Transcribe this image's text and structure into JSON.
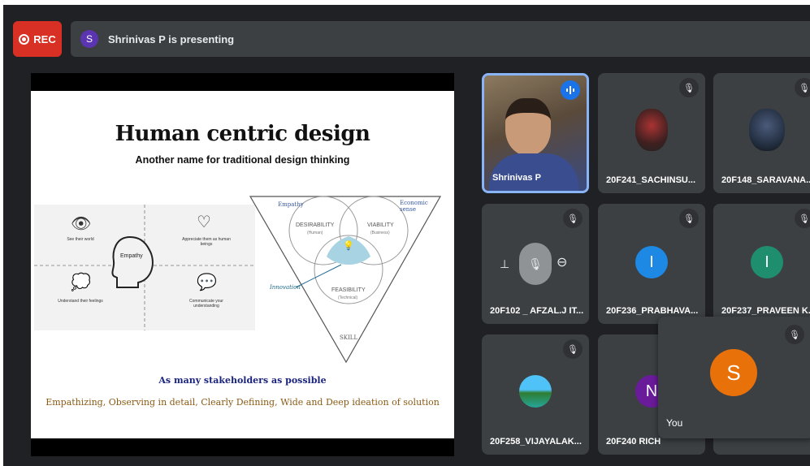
{
  "recording": {
    "label": "REC"
  },
  "presenter_bar": {
    "avatar_letter": "S",
    "text": "Shrinivas P is presenting"
  },
  "slide": {
    "title": "Human centric design",
    "subtitle": "Another name for traditional design thinking",
    "empathy_center": "Empathy",
    "empathy_items": [
      "See their world",
      "Appreciate them as human beings",
      "Understand their feelings",
      "Communicate your understanding"
    ],
    "venn": {
      "top_left": "Empathy",
      "top_right": "Economic sense",
      "circle_desirability": "DESIRABILITY",
      "circle_desirability_sub": "(Human)",
      "circle_viability": "VIABILITY",
      "circle_viability_sub": "(Business)",
      "circle_feasibility": "FEASIBILITY",
      "circle_feasibility_sub": "(Technical)",
      "innovation": "Innovation",
      "skill": "SKILL"
    },
    "stakeholders": "As many stakeholders as possible",
    "methods": "Empathizing, Observing in detail, Clearly Defining, Wide and Deep ideation of solution"
  },
  "participants": [
    {
      "name": "Shrinivas P",
      "type": "video",
      "speaking": true
    },
    {
      "name": "20F241_SACHINSU...",
      "type": "photo",
      "muted": true
    },
    {
      "name": "20F148_SARAVANA...",
      "type": "photo",
      "muted": true
    },
    {
      "name": "20F102 _ AFZAL.J IT...",
      "type": "controls",
      "muted": true
    },
    {
      "name": "20F236_PRABHAVA...",
      "type": "letter",
      "letter": "I",
      "color": "#1e88e5",
      "muted": true
    },
    {
      "name": "20F237_PRAVEEN K...",
      "type": "letter",
      "letter": "I",
      "color": "#1e8e6e",
      "muted": true
    },
    {
      "name": "20F258_VIJAYALAK...",
      "type": "photo",
      "muted": true
    },
    {
      "name": "20F240 RICH",
      "type": "letter",
      "letter": "N",
      "color": "#6a1b9a",
      "muted": true
    }
  ],
  "self_view": {
    "letter": "S",
    "label": "You",
    "color": "#e8710a"
  },
  "colors": {
    "background": "#202124",
    "tile": "#3c4043",
    "rec": "#d93025",
    "speaking": "#8ab4f8"
  }
}
